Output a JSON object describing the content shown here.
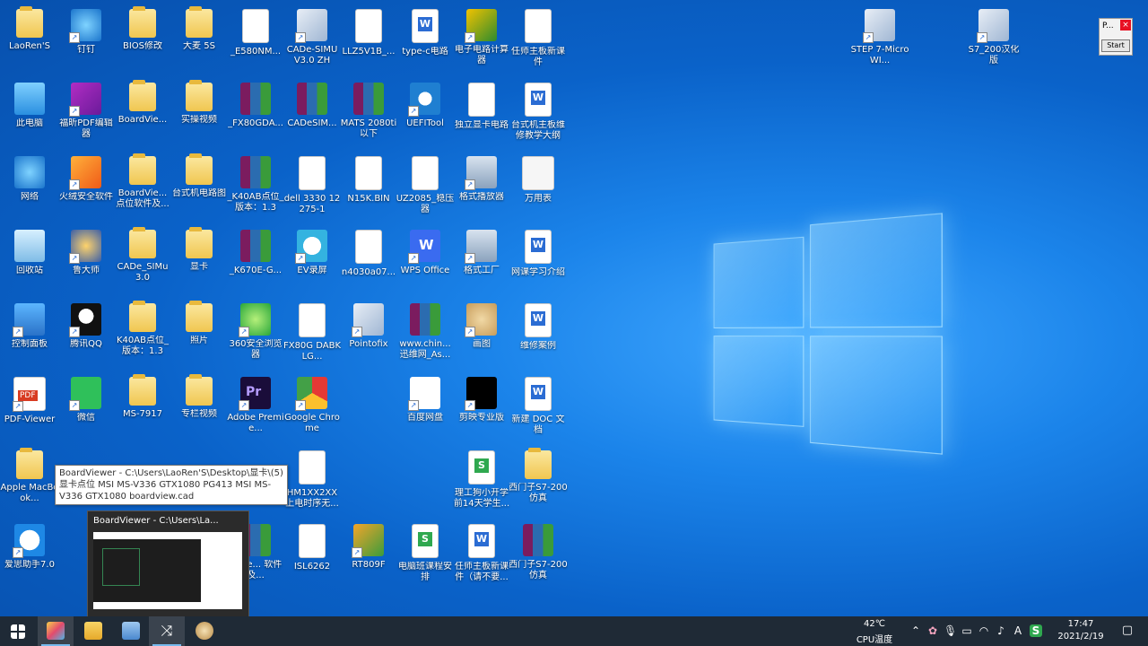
{
  "desktop_icons": [
    {
      "label": "LaoRen'S",
      "icon": "user-folder-icon"
    },
    {
      "label": "钉钉",
      "icon": "dingtalk-icon"
    },
    {
      "label": "BIOS修改",
      "icon": "folder-icon"
    },
    {
      "label": "大麦 5S",
      "icon": "folder-icon"
    },
    {
      "label": "_E580NM...",
      "icon": "document-icon"
    },
    {
      "label": "CADe-SIMU V3.0 ZH",
      "icon": "cade-simu-icon"
    },
    {
      "label": "LLZ5V1B_...",
      "icon": "document-icon"
    },
    {
      "label": "type-c电路",
      "icon": "word-document-icon"
    },
    {
      "label": "电子电路计算器",
      "icon": "chinafix-icon"
    },
    {
      "label": "任师主板新课件",
      "icon": "document-icon"
    },
    {
      "label": "此电脑",
      "icon": "computer-icon"
    },
    {
      "label": "福昕PDF编辑器",
      "icon": "foxit-pdf-icon"
    },
    {
      "label": "BoardVie...",
      "icon": "folder-icon"
    },
    {
      "label": "实操视频",
      "icon": "folder-icon"
    },
    {
      "label": "_FX80GDA...",
      "icon": "winrar-icon"
    },
    {
      "label": "CADeSIM...",
      "icon": "winrar-icon"
    },
    {
      "label": "MATS 2080ti以下",
      "icon": "winrar-icon"
    },
    {
      "label": "UEFITool",
      "icon": "uefitool-icon"
    },
    {
      "label": "独立显卡电路",
      "icon": "document-icon"
    },
    {
      "label": "台式机主板维修教学大纲",
      "icon": "word-document-icon"
    },
    {
      "label": "网络",
      "icon": "network-icon"
    },
    {
      "label": "火绒安全软件",
      "icon": "huorong-shield-icon"
    },
    {
      "label": "BoardVie... 点位软件及...",
      "icon": "folder-icon"
    },
    {
      "label": "台式机电路图",
      "icon": "folder-icon"
    },
    {
      "label": "_K40AB点位_版本：1.3",
      "icon": "winrar-icon"
    },
    {
      "label": "dell 3330 12275-1",
      "icon": "document-icon"
    },
    {
      "label": "N15K.BIN",
      "icon": "file-icon"
    },
    {
      "label": "UZ2085_稳压器",
      "icon": "document-icon"
    },
    {
      "label": "格式播放器",
      "icon": "format-player-icon"
    },
    {
      "label": "万用表",
      "icon": "multimeter-icon"
    },
    {
      "label": "回收站",
      "icon": "recycle-bin-icon"
    },
    {
      "label": "鲁大师",
      "icon": "ludashi-icon"
    },
    {
      "label": "CADe_SIMu 3.0",
      "icon": "folder-icon"
    },
    {
      "label": "显卡",
      "icon": "folder-icon"
    },
    {
      "label": "_K670E-G...",
      "icon": "winrar-icon"
    },
    {
      "label": "EV录屏",
      "icon": "ev-recorder-icon"
    },
    {
      "label": "n4030a07...",
      "icon": "file-icon"
    },
    {
      "label": "WPS Office",
      "icon": "wps-office-icon"
    },
    {
      "label": "格式工厂",
      "icon": "format-factory-icon"
    },
    {
      "label": "网课学习介绍",
      "icon": "word-document-icon"
    },
    {
      "label": "控制面板",
      "icon": "control-panel-icon"
    },
    {
      "label": "腾讯QQ",
      "icon": "qq-icon"
    },
    {
      "label": "K40AB点位_版本：1.3",
      "icon": "folder-icon"
    },
    {
      "label": "照片",
      "icon": "folder-icon"
    },
    {
      "label": "360安全浏览器",
      "icon": "360-browser-icon"
    },
    {
      "label": "FX80G DABKLG...",
      "icon": "file-icon"
    },
    {
      "label": "Pointofix",
      "icon": "pointofix-icon"
    },
    {
      "label": "www.chin... 迅维网_As...",
      "icon": "winrar-icon"
    },
    {
      "label": "画图",
      "icon": "paint-icon"
    },
    {
      "label": "维修案例",
      "icon": "word-document-icon"
    },
    {
      "label": "PDF-Viewer",
      "icon": "pdf-viewer-icon"
    },
    {
      "label": "微信",
      "icon": "wechat-icon"
    },
    {
      "label": "MS-7917",
      "icon": "folder-icon"
    },
    {
      "label": "专栏视频",
      "icon": "folder-icon"
    },
    {
      "label": "Adobe Premie...",
      "icon": "premiere-icon"
    },
    {
      "label": "Google Chrome",
      "icon": "chrome-icon"
    },
    {
      "label": "百度网盘",
      "icon": "baidu-netdisk-icon"
    },
    {
      "label": "剪映专业版",
      "icon": "capcut-icon"
    },
    {
      "label": "新建 DOC 文档",
      "icon": "word-document-icon"
    },
    {
      "label": "Apple MacBook...",
      "icon": "folder-icon"
    },
    {
      "label": "HM1XX2XX 上电时序无...",
      "icon": "document-icon"
    },
    {
      "label": "理工狗小开学前14天学生...",
      "icon": "wps-sheet-icon"
    },
    {
      "label": "西门子S7-200仿真",
      "icon": "folder-icon"
    },
    {
      "label": "爱思助手7.0",
      "icon": "i4-assistant-icon"
    },
    {
      "label": "rdVie... 软件及...",
      "icon": "winrar-icon"
    },
    {
      "label": "ISL6262",
      "icon": "document-icon"
    },
    {
      "label": "RT809F",
      "icon": "rt809f-icon"
    },
    {
      "label": "电脑班课程安排",
      "icon": "wps-sheet-icon"
    },
    {
      "label": "任师主板新课件（请不要...",
      "icon": "word-document-icon"
    },
    {
      "label": "西门子S7-200仿真",
      "icon": "winrar-icon"
    },
    {
      "label": "STEP 7-MicroWI...",
      "icon": "step7-icon"
    },
    {
      "label": "S7_200汉化版",
      "icon": "s7-200-icon"
    }
  ],
  "tooltip": "BoardViewer  -  C:\\Users\\LaoRen'S\\Desktop\\显卡\\(5)显卡点位 MSI MS-V336 GTX1080 PG413 MSI MS-V336 GTX1080 boardview.cad",
  "preview": {
    "title": "BoardViewer  -  C:\\Users\\La..."
  },
  "mini_window": {
    "title": "P...",
    "close": "×",
    "button": "Start"
  },
  "taskbar": {
    "apps": [
      {
        "name": "pointofix-task-icon",
        "active": true
      },
      {
        "name": "file-explorer-icon",
        "active": false
      },
      {
        "name": "pdf-viewer-task-icon",
        "active": false
      },
      {
        "name": "boardviewer-task-icon",
        "active": true
      },
      {
        "name": "paint-task-icon",
        "active": false
      }
    ],
    "temperature": "42℃",
    "temperature_label": "CPU温度",
    "ime": "A",
    "time": "17:47",
    "date": "2021/2/19"
  }
}
